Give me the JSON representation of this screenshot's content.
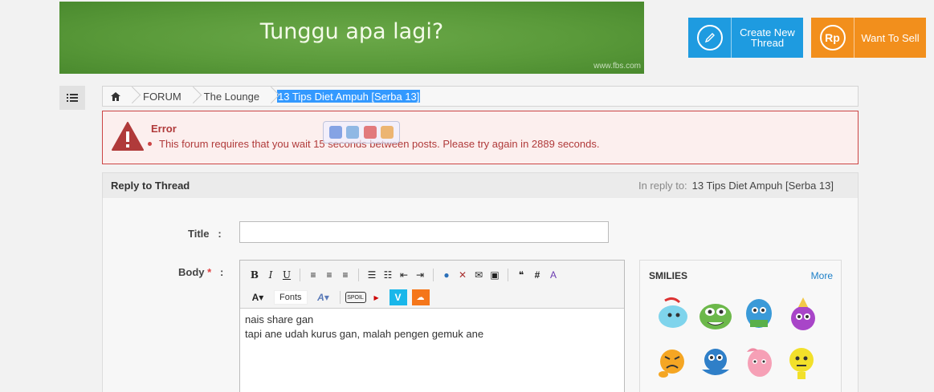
{
  "banner": {
    "text": "Tunggu apa lagi?",
    "url": "www.fbs.com"
  },
  "buttons": {
    "create": {
      "label": "Create New\nThread",
      "icon": "pencil-icon",
      "color": "#1e9be0"
    },
    "sell": {
      "label": "Want To Sell",
      "icon": "Rp",
      "color": "#f28f1c"
    }
  },
  "breadcrumb": {
    "items": [
      "FORUM",
      "The Lounge"
    ],
    "current": "13 Tips Diet Ampuh [Serba 13]"
  },
  "error": {
    "title": "Error",
    "message": "This forum requires that you wait 15 seconds between posts. Please try again in 2889 seconds."
  },
  "reply": {
    "header": "Reply to Thread",
    "in_reply_label": "In reply to:",
    "in_reply_value": "13 Tips Diet Ampuh [Serba 13]",
    "title_label": "Title",
    "body_label": "Body",
    "required_mark": "*",
    "colon": ":",
    "fonts_label": "Fonts",
    "body_lines": [
      "nais share gan",
      "tapi ane udah kurus gan, malah pengen gemuk ane"
    ]
  },
  "smilies": {
    "title": "SMILIES",
    "more": "More"
  },
  "colors": {
    "accent_blue": "#1e9be0",
    "accent_orange": "#f28f1c",
    "error_red": "#b03a3a"
  }
}
